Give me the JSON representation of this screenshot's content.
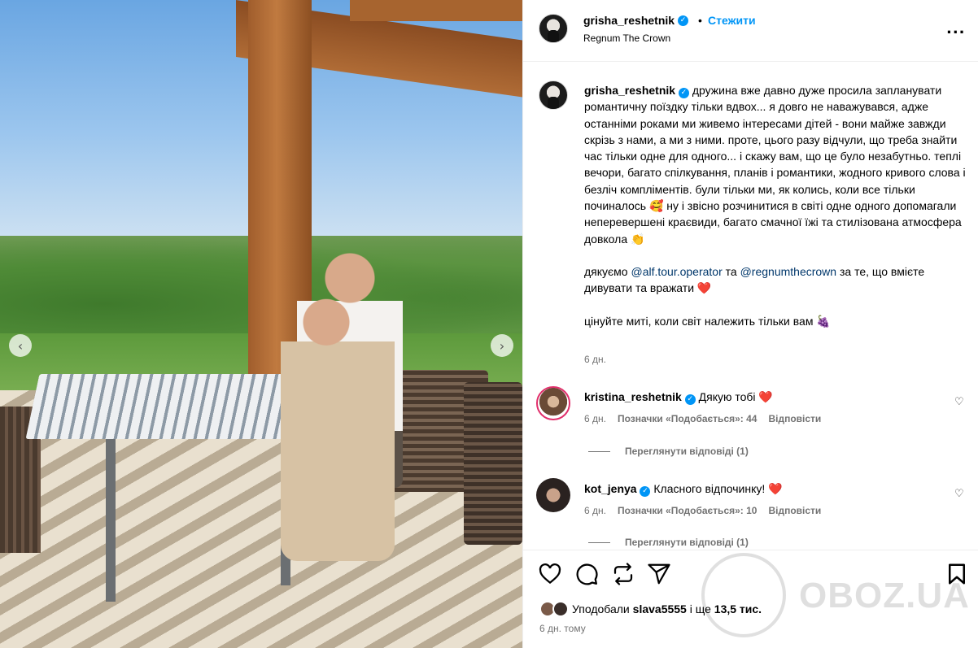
{
  "header": {
    "username": "grisha_reshetnik",
    "follow_label": "Стежити",
    "separator": "•",
    "location": "Regnum The Crown",
    "more_label": "..."
  },
  "caption": {
    "username": "grisha_reshetnik",
    "text1": "дружина вже давно дуже просила запланувати романтичну поїздку тільки вдвох... я довго не наважувався, адже останніми роками ми живемо інтересами дітей - вони майже завжди скрізь з нами, а ми з ними. проте, цього разу відчули, що треба знайти час тільки одне для одного... і скажу вам, що це було незабутньо. теплі вечори, багато спілкування, планів і романтики, жодного кривого слова і безліч компліментів. були тільки ми, як колись, коли все тільки починалось 🥰 ну і звісно розчинитися в світі одне одного допомагали неперевершені краєвиди, багато смачної їжі та стилізована атмосфера довкола 👏",
    "thanks_prefix": "дякуємо",
    "mention1": "@alf.tour.operator",
    "thanks_and": "та",
    "mention2": "@regnumthecrown",
    "thanks_suffix": "за те, що вмієте дивувати та вражати ❤️",
    "text3": "цінуйте миті, коли світ належить тільки вам 🍇",
    "time": "6 дн."
  },
  "comments": [
    {
      "username": "kristina_reshetnik",
      "text": "Дякую тобі ❤️",
      "time": "6 дн.",
      "likes": "Позначки «Подобається»: 44",
      "reply_label": "Відповісти",
      "view_replies": "Переглянути відповіді (1)"
    },
    {
      "username": "kot_jenya",
      "text": "Класного відпочинку! ❤️",
      "time": "6 дн.",
      "likes": "Позначки «Подобається»: 10",
      "reply_label": "Відповісти",
      "view_replies": "Переглянути відповіді (1)"
    }
  ],
  "footer": {
    "liked_by_prefix": "Уподобали",
    "liked_by_user": "slava5555",
    "liked_by_middle": "і ще",
    "liked_by_count": "13,5 тис.",
    "date": "6 дн. тому"
  },
  "watermark": {
    "text": "OBOZ.UA"
  },
  "icons": {
    "heart": "heart-icon",
    "comment": "comment-icon",
    "repost": "repost-icon",
    "share": "share-icon",
    "save": "bookmark-icon"
  },
  "colors": {
    "accent": "#0095f6",
    "mention": "#00376b",
    "muted": "#737373",
    "heart": "#e1306c"
  }
}
